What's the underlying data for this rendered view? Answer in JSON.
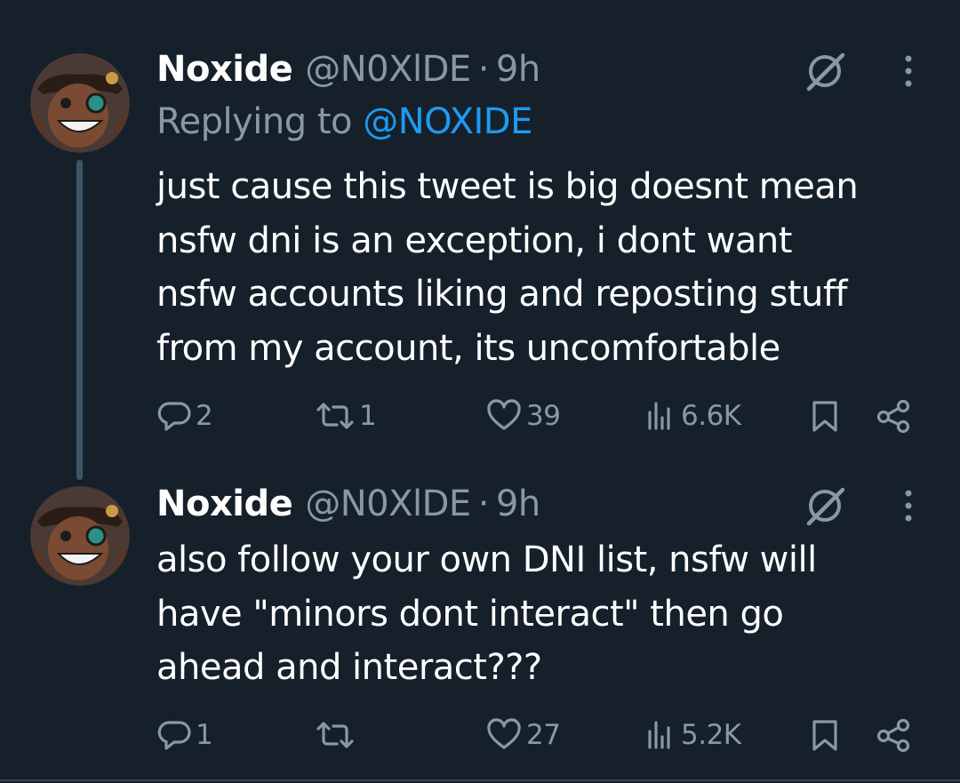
{
  "tweets": [
    {
      "name": "Noxide",
      "handle": "@N0XlDE",
      "separator": "·",
      "time": "9h",
      "replying_prefix": "Replying to",
      "replying_handle": "@NOXIDE",
      "lines": [
        "just cause this tweet is big doesnt mean",
        "nsfw dni is an exception, i dont want",
        "nsfw accounts liking and reposting stuff",
        "from my account, its uncomfortable"
      ],
      "replies": "2",
      "reposts": "1",
      "likes": "39",
      "views": "6.6K"
    },
    {
      "name": "Noxide",
      "handle": "@N0XlDE",
      "separator": "·",
      "time": "9h",
      "lines": [
        "also follow your own DNI list, nsfw will",
        "have \"minors dont interact\" then go",
        "ahead and interact???"
      ],
      "replies": "1",
      "reposts": "",
      "likes": "27",
      "views": "5.2K"
    }
  ],
  "icons": {
    "reply": "reply-icon",
    "repost": "repost-icon",
    "like": "heart-icon",
    "views": "views-icon",
    "bookmark": "bookmark-icon",
    "share": "share-icon",
    "grok": "grok-icon",
    "more": "more-icon"
  },
  "colors": {
    "background": "#15202b",
    "text": "#ffffff",
    "secondary": "#8899a6",
    "link": "#1d9bf0",
    "thread_line": "#3d5466"
  }
}
